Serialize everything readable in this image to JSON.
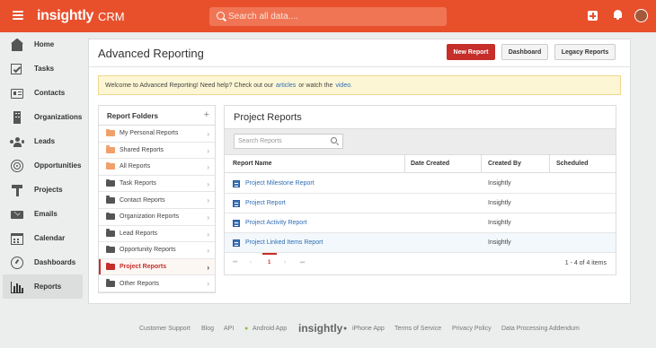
{
  "header": {
    "logo": "insightly",
    "section": "CRM",
    "search_placeholder": "Search all data...."
  },
  "sidebar": {
    "items": [
      {
        "label": "Home",
        "icon": "home-icon"
      },
      {
        "label": "Tasks",
        "icon": "tasks-icon"
      },
      {
        "label": "Contacts",
        "icon": "contacts-icon"
      },
      {
        "label": "Organizations",
        "icon": "organizations-icon"
      },
      {
        "label": "Leads",
        "icon": "leads-icon"
      },
      {
        "label": "Opportunities",
        "icon": "opportunities-icon"
      },
      {
        "label": "Projects",
        "icon": "projects-icon"
      },
      {
        "label": "Emails",
        "icon": "emails-icon"
      },
      {
        "label": "Calendar",
        "icon": "calendar-icon"
      },
      {
        "label": "Dashboards",
        "icon": "dashboards-icon"
      },
      {
        "label": "Reports",
        "icon": "reports-icon"
      }
    ],
    "active": "Reports"
  },
  "page": {
    "title": "Advanced Reporting",
    "buttons": {
      "new_report": "New Report",
      "dashboard": "Dashboard",
      "legacy": "Legacy Reports"
    },
    "alert": {
      "text_before": "Welcome to Advanced Reporting! Need help? Check out our",
      "link1": "articles",
      "text_middle": "or watch the",
      "link2": "video."
    }
  },
  "folders": {
    "title": "Report Folders",
    "add": "+",
    "items": [
      {
        "label": "My Personal Reports",
        "color": "#f0a06a"
      },
      {
        "label": "Shared Reports",
        "color": "#f0a06a"
      },
      {
        "label": "All Reports",
        "color": "#f0a06a"
      },
      {
        "label": "Task Reports",
        "color": "#555555"
      },
      {
        "label": "Contact Reports",
        "color": "#555555"
      },
      {
        "label": "Organization Reports",
        "color": "#555555"
      },
      {
        "label": "Lead Reports",
        "color": "#555555"
      },
      {
        "label": "Opportunity Reports",
        "color": "#555555"
      },
      {
        "label": "Project Reports",
        "color": "#c62e2a"
      },
      {
        "label": "Other Reports",
        "color": "#555555"
      }
    ],
    "active": "Project Reports"
  },
  "reports": {
    "title": "Project Reports",
    "search_placeholder": "Search Reports",
    "columns": [
      "Report Name",
      "Date Created",
      "Created By",
      "Scheduled"
    ],
    "rows": [
      {
        "name": "Project Milestone Report",
        "date_created": "",
        "created_by": "Insightly",
        "scheduled": ""
      },
      {
        "name": "Project Report",
        "date_created": "",
        "created_by": "Insightly",
        "scheduled": ""
      },
      {
        "name": "Project Activity Report",
        "date_created": "",
        "created_by": "Insightly",
        "scheduled": ""
      },
      {
        "name": "Project Linked Items Report",
        "date_created": "",
        "created_by": "Insightly",
        "scheduled": ""
      }
    ],
    "pagination": {
      "first": "⏮",
      "prev": "‹",
      "current": "1",
      "next": "›",
      "last": "⏭",
      "count": "1 - 4 of 4 items"
    }
  },
  "footer": {
    "links": [
      "Customer Support",
      "Blog",
      "API",
      "Android App",
      "iPhone App",
      "Terms of Service",
      "Privacy Policy",
      "Data Processing Addendum"
    ],
    "logo": "insightly"
  },
  "colors": {
    "brand": "#e8502c",
    "primary_button": "#c62e2a",
    "link": "#2f6db3",
    "alert_bg": "#fcf6d4"
  }
}
